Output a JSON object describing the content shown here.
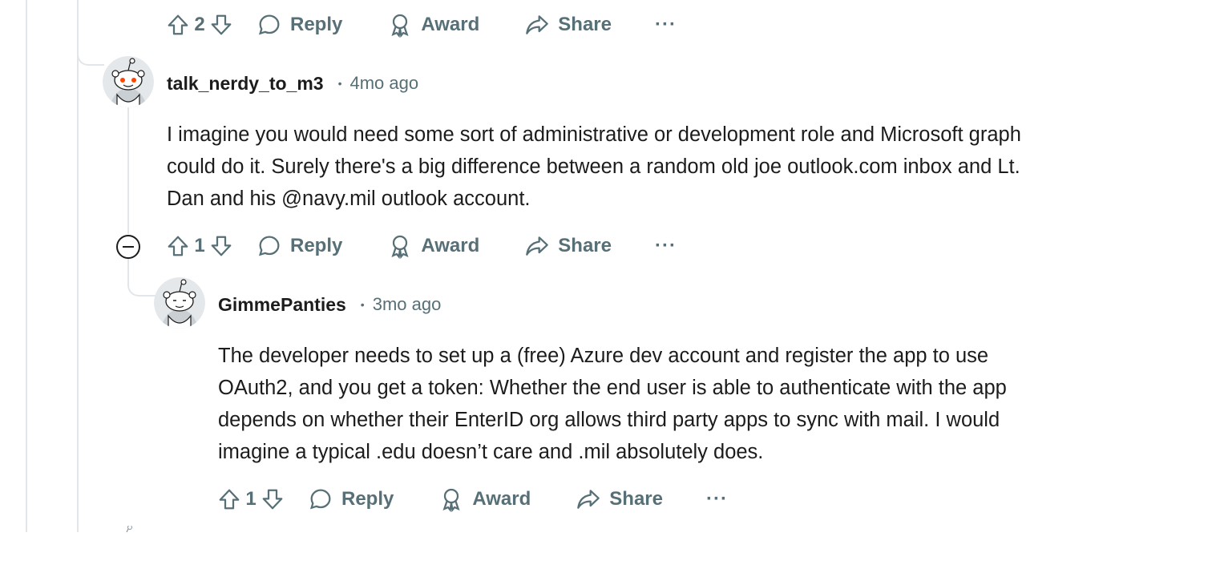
{
  "top_actions": {
    "vote_count": "2",
    "reply_label": "Reply",
    "award_label": "Award",
    "share_label": "Share",
    "more_label": "···"
  },
  "comments": [
    {
      "author": "talk_nerdy_to_m3",
      "separator": "•",
      "time": "4mo ago",
      "lines": [
        "I imagine you would need some sort of administrative or development role and Microsoft graph",
        "could do it. Surely there's a big difference between a random old joe outlook.com inbox and Lt.",
        "Dan and his @navy.mil outlook account."
      ],
      "vote_count": "1",
      "reply_label": "Reply",
      "award_label": "Award",
      "share_label": "Share",
      "more_label": "···"
    },
    {
      "author": "GimmePanties",
      "separator": "•",
      "time": "3mo ago",
      "lines": [
        "The developer needs to set up a (free) Azure dev account and register the app to use",
        "OAuth2, and you get a token: Whether the end user is able to authenticate with the app",
        "depends on whether their EnterID org allows third party apps to sync with mail. I would",
        "imagine a typical .edu doesn’t care and .mil absolutely does."
      ],
      "vote_count": "1",
      "reply_label": "Reply",
      "award_label": "Award",
      "share_label": "Share",
      "more_label": "···"
    }
  ],
  "colors": {
    "meta": "#576f76",
    "text": "#1c1c1c",
    "thread_line": "#e3e6e8",
    "avatar_accent": "#ff4500"
  },
  "icons": [
    "upvote-icon",
    "downvote-icon",
    "reply-bubble-icon",
    "award-icon",
    "share-icon",
    "more-icon",
    "collapse-icon",
    "snoo-avatar-icon"
  ]
}
